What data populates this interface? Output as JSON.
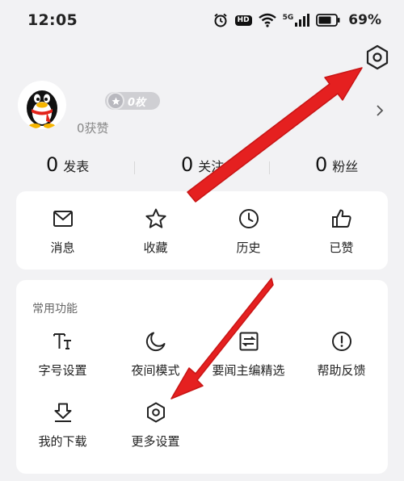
{
  "status_bar": {
    "time": "12:05",
    "hd_label": "HD",
    "network_label": "5G",
    "battery": "69%"
  },
  "profile": {
    "medal_count": "0枚",
    "likes": "0获赞"
  },
  "stats": [
    {
      "value": "0",
      "label": "发表"
    },
    {
      "value": "0",
      "label": "关注"
    },
    {
      "value": "0",
      "label": "粉丝"
    }
  ],
  "quick_actions": [
    {
      "label": "消息",
      "icon": "mail-icon"
    },
    {
      "label": "收藏",
      "icon": "star-icon"
    },
    {
      "label": "历史",
      "icon": "clock-icon"
    },
    {
      "label": "已赞",
      "icon": "thumbs-up-icon"
    }
  ],
  "common_functions": {
    "title": "常用功能",
    "items": [
      {
        "label": "字号设置",
        "icon": "font-size-icon"
      },
      {
        "label": "夜间模式",
        "icon": "moon-icon"
      },
      {
        "label": "要闻主编精选",
        "icon": "editor-picks-icon"
      },
      {
        "label": "帮助反馈",
        "icon": "help-icon"
      },
      {
        "label": "我的下载",
        "icon": "download-icon"
      },
      {
        "label": "更多设置",
        "icon": "hexagon-settings-icon"
      }
    ]
  },
  "colors": {
    "background": "#f2f2f4",
    "card": "#ffffff",
    "arrow": "#e52020",
    "text": "#222222",
    "muted": "#888888"
  }
}
